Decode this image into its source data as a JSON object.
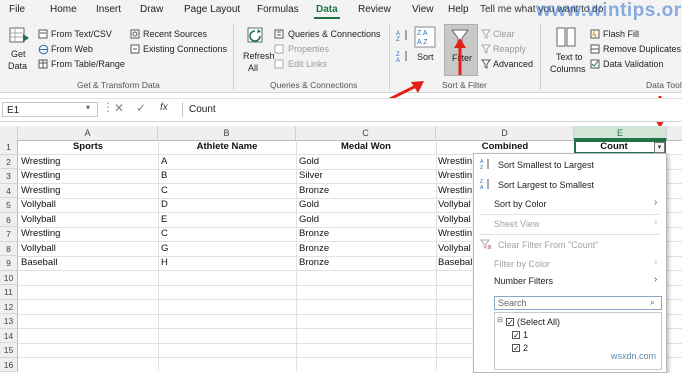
{
  "tabs": [
    "File",
    "Home",
    "Insert",
    "Draw",
    "Page Layout",
    "Formulas",
    "Data",
    "Review",
    "View",
    "Help"
  ],
  "active_tab": "Data",
  "tell_me": "Tell me what you want to do",
  "watermark": "www.wintips.org",
  "ribbon": {
    "get_data": "Get",
    "get_data2": "Data",
    "from_text_csv": "From Text/CSV",
    "from_web": "From Web",
    "from_table_range": "From Table/Range",
    "recent_sources": "Recent Sources",
    "existing_connections": "Existing Connections",
    "group_get_transform": "Get & Transform Data",
    "refresh": "Refresh",
    "refresh_all": "All",
    "queries_connections": "Queries & Connections",
    "properties": "Properties",
    "edit_links": "Edit Links",
    "group_queries": "Queries & Connections",
    "sort": "Sort",
    "filter": "Filter",
    "clear": "Clear",
    "reapply": "Reapply",
    "advanced": "Advanced",
    "group_sort_filter": "Sort & Filter",
    "text_to_columns": "Text to",
    "text_to_columns2": "Columns",
    "flash_fill": "Flash Fill",
    "remove_duplicates": "Remove Duplicates",
    "data_validation": "Data Validation",
    "group_data_tools": "Data Tools"
  },
  "formula_bar": {
    "name_box": "E1",
    "fx": "fx",
    "content": "Count"
  },
  "columns": [
    "A",
    "B",
    "C",
    "D",
    "E"
  ],
  "rows": [
    "1",
    "2",
    "3",
    "4",
    "5",
    "6",
    "7",
    "8",
    "9",
    "10",
    "11",
    "12",
    "13",
    "14",
    "15",
    "16"
  ],
  "table": {
    "headers": [
      "Sports",
      "Athlete Name",
      "Medal Won",
      "Combined",
      "Count"
    ],
    "rows": [
      [
        "Wrestling",
        "A",
        "Gold",
        "Wrestlin"
      ],
      [
        "Wrestling",
        "B",
        "Silver",
        "Wrestlin"
      ],
      [
        "Wrestling",
        "C",
        "Bronze",
        "Wrestlin"
      ],
      [
        "Vollyball",
        "D",
        "Gold",
        "Vollybal"
      ],
      [
        "Vollyball",
        "E",
        "Gold",
        "Vollybal"
      ],
      [
        "Wrestling",
        "C",
        "Bronze",
        "Wrestlin"
      ],
      [
        "Vollyball",
        "G",
        "Bronze",
        "Vollybal"
      ],
      [
        "Baseball",
        "H",
        "Bronze",
        "Basebal"
      ]
    ]
  },
  "dropdown": {
    "sort_asc": "Sort Smallest to Largest",
    "sort_desc": "Sort Largest to Smallest",
    "sort_color": "Sort by Color",
    "sheet_view": "Sheet View",
    "clear_filter": "Clear Filter From \"Count\"",
    "filter_color": "Filter by Color",
    "number_filters": "Number Filters",
    "search_placeholder": "Search",
    "list": [
      "(Select All)",
      "1",
      "2"
    ]
  },
  "site_logo": "wsxdn.com",
  "colors": {
    "accent": "#217346",
    "arrow": "#e0221a",
    "watermark": "#2e6fd0"
  }
}
